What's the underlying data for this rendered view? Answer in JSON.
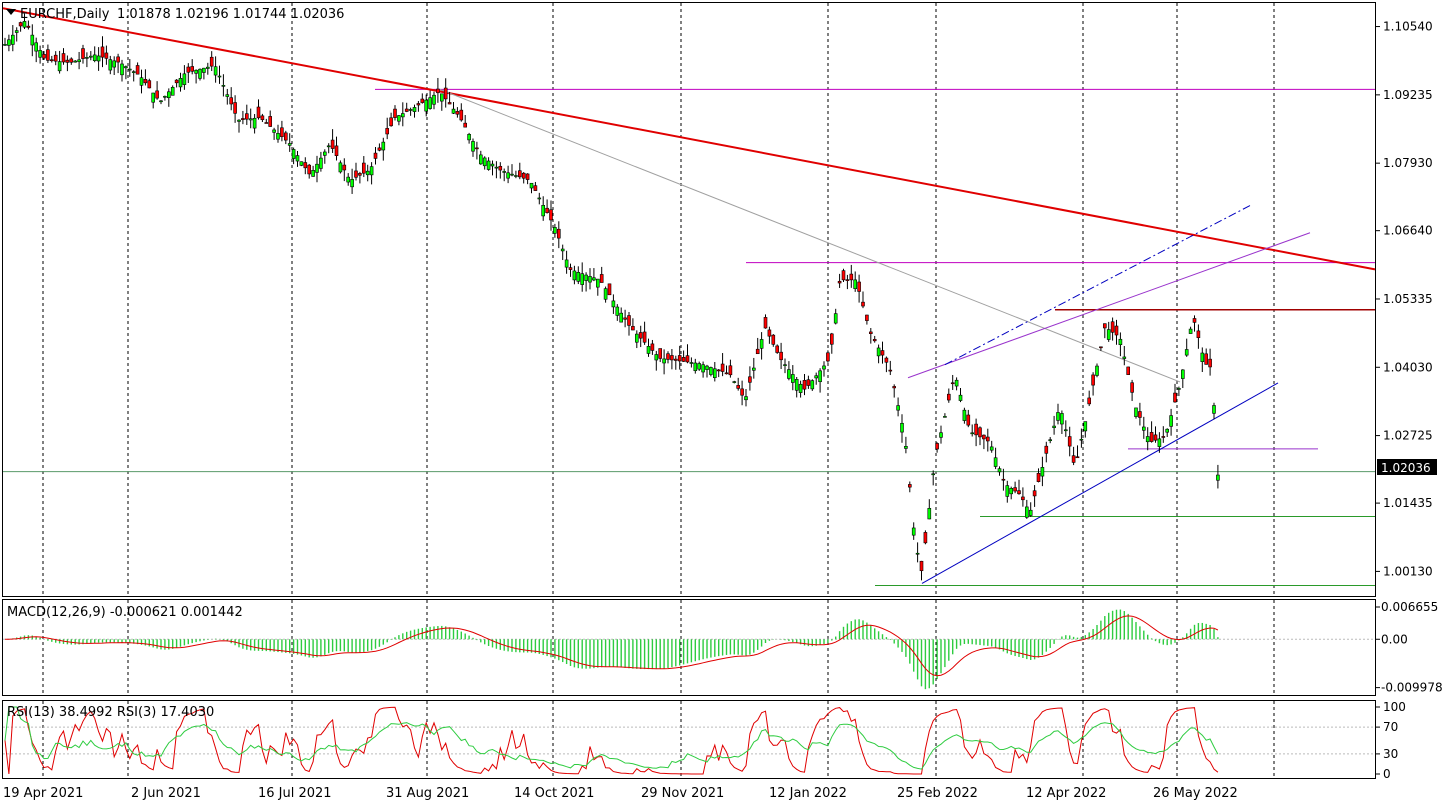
{
  "chart_data": [
    {
      "type": "candlestick",
      "panel": "price",
      "title": "EURCHF,Daily",
      "ohlc_readout": "1.01878 1.02196 1.01744 1.02036",
      "current_price_label": "1.02036",
      "current_price": 1.02036,
      "y_ticks": [
        "1.10540",
        "1.09235",
        "1.07930",
        "1.06640",
        "1.05335",
        "1.04030",
        "1.02725",
        "1.01435",
        "1.00130"
      ],
      "ylim": [
        0.9966,
        1.1099
      ],
      "x_date_labels": [
        "19 Apr 2021",
        "2 Jun 2021",
        "16 Jul 2021",
        "31 Aug 2021",
        "14 Oct 2021",
        "29 Nov 2021",
        "12 Jan 2022",
        "25 Feb 2022",
        "12 Apr 2022",
        "26 May 2022"
      ],
      "grid": "vertical dashed at date labels",
      "colors": {
        "bull": "#00ff00",
        "bear": "#ff0000",
        "candle_outline": "#000000",
        "resistance_trend": "#e00000",
        "support_trend": "#0000c0",
        "magenta_levels": "#c000c0",
        "green_levels": "#2a9a2a",
        "gray_trend": "#a0a0a0",
        "purple_channel": "#9933cc"
      },
      "horizontal_levels": [
        {
          "price": 1.0934,
          "color": "magenta"
        },
        {
          "price": 1.0603,
          "color": "magenta"
        },
        {
          "price": 1.0513,
          "color": "darkred"
        },
        {
          "price": 1.0247,
          "color": "purple"
        },
        {
          "price": 1.0118,
          "color": "green"
        },
        {
          "price": 0.9986,
          "color": "green"
        },
        {
          "price": 1.02036,
          "color": "seagreen"
        }
      ],
      "description_series": "daily candles Apr 2021 to Jun 2022"
    },
    {
      "type": "bar",
      "panel": "macd",
      "label": "MACD(12,26,9) -0.000621 0.001442",
      "y_ticks": [
        "0.006655",
        "0.00",
        "-0.009978"
      ],
      "ylim": [
        -0.0115,
        0.0081
      ],
      "colors": {
        "histogram": "#2ecc40",
        "signal": "#e00000"
      }
    },
    {
      "type": "line",
      "panel": "rsi",
      "label": "RSI(13) 38.4992  RSI(3) 17.4030",
      "y_ticks": [
        "100",
        "70",
        "30",
        "0"
      ],
      "ylim": [
        0,
        100
      ],
      "levels": [
        70,
        30
      ],
      "colors": {
        "rsi13": "#2ecc40",
        "rsi3": "#e00000"
      }
    }
  ]
}
